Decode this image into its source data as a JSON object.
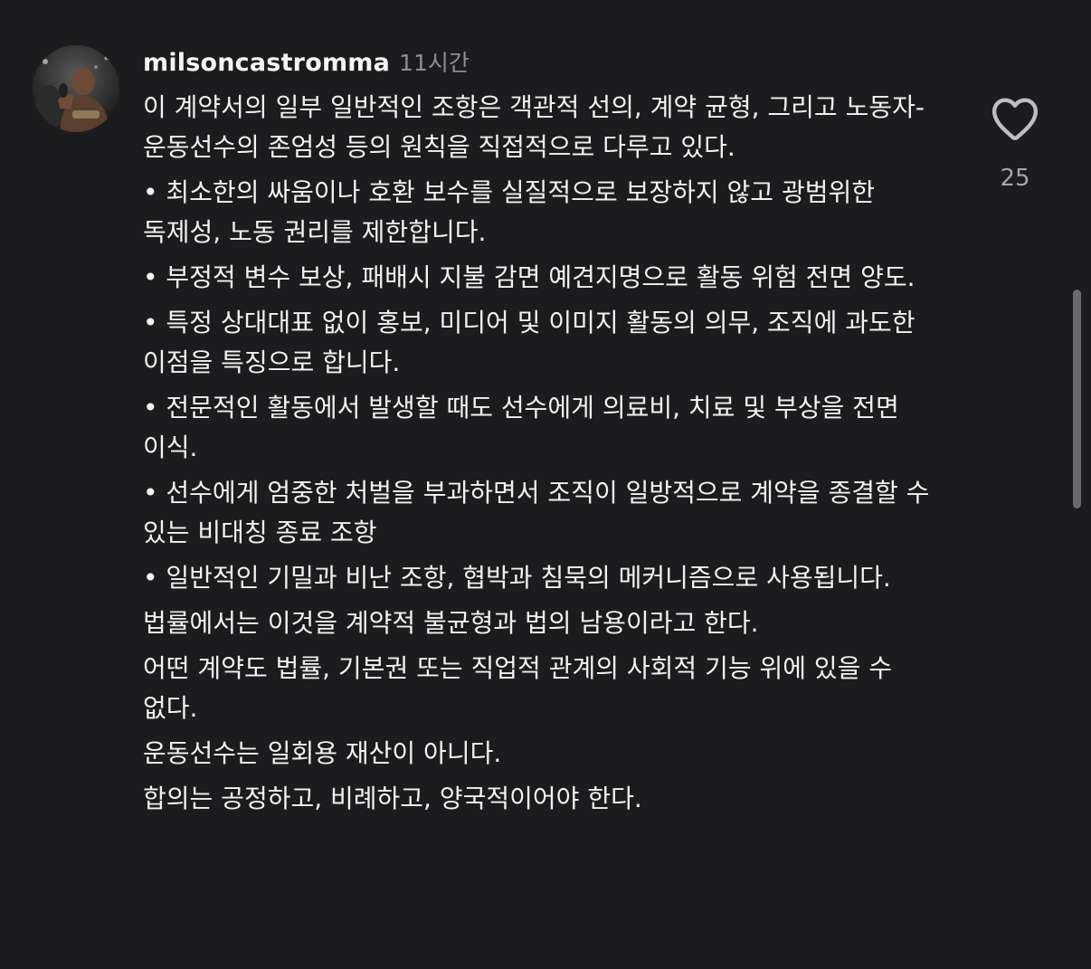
{
  "comment": {
    "username": "milsoncastromma",
    "time": "11시간",
    "paragraphs": [
      "이 계약서의 일부 일반적인 조항은 객관적 선의, 계약 균형, 그리고 노동자-운동선수의 존엄성 등의 원칙을 직접적으로 다루고 있다.",
      "• 최소한의 싸움이나 호환 보수를 실질적으로 보장하지 않고 광범위한 독제성, 노동 권리를 제한합니다.",
      "• 부정적 변수 보상, 패배시 지불 감면 예견지명으로 활동 위험 전면 양도.",
      "• 특정 상대대표 없이 홍보, 미디어 및 이미지 활동의 의무, 조직에 과도한 이점을 특징으로 합니다.",
      "• 전문적인 활동에서 발생할 때도 선수에게 의료비, 치료 및 부상을 전면 이식.",
      "• 선수에게 엄중한 처벌을 부과하면서 조직이 일방적으로 계약을 종결할 수 있는 비대칭 종료 조항",
      "• 일반적인 기밀과 비난 조항, 협박과 침묵의 메커니즘으로 사용됩니다.",
      "법률에서는 이것을 계약적 불균형과 법의 남용이라고 한다.",
      "어떤 계약도 법률, 기본권 또는 직업적 관계의 사회적 기능 위에 있을 수 없다.",
      "운동선수는 일회용 재산이 아니다.",
      "합의는 공정하고, 비례하고, 양국적이어야 한다."
    ],
    "like_count": "25",
    "like_icon": "heart-outline-icon"
  },
  "colors": {
    "background": "#1c1c1e",
    "text": "#f2f2f2",
    "muted": "#8e8e93",
    "icon": "#bdbdc2"
  }
}
